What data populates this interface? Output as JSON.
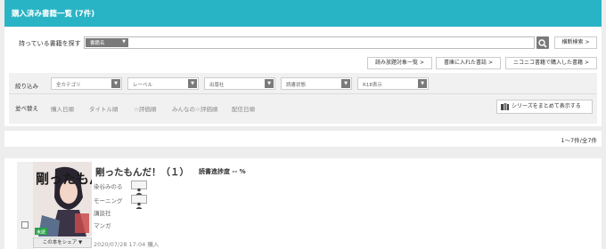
{
  "header": {
    "title": "購入済み書籍一覧 (7件)"
  },
  "search": {
    "label": "持っている書籍を探す",
    "select_value": "書籍名",
    "advanced_label": "横断検索 >"
  },
  "links": {
    "unlimited": "読み放題対象一覧 >",
    "bookshelf": "書庫に入れた書誌 >",
    "niconico": "ニコニコ書籍で購入した書籍 >"
  },
  "filter": {
    "label": "絞り込み",
    "selects": [
      "全カテゴリ",
      "レーベル",
      "出版社",
      "読書状態",
      "R18表示"
    ]
  },
  "sort": {
    "label": "並べ替え",
    "options": [
      "購入日順",
      "タイトル順",
      "☆評価順",
      "みんなの☆評価順",
      "配信日順"
    ]
  },
  "series_button": "シリーズをまとめて表示する",
  "count_text": "1〜7件/全7件",
  "book": {
    "title": "剛ったもんだ！（１）",
    "progress": "読書進捗度 -- %",
    "authors": [
      "染谷みのる",
      "モーニング"
    ],
    "publisher": "講談社",
    "category": "マンガ",
    "share": "この本をシェア ▼",
    "purchase_date": "2020/07/28 17:04 購入",
    "badge": "未読",
    "cover_title": "剛ったもんだ"
  },
  "colors": {
    "accent": "#29b4c5",
    "button_dark": "#7a7a7a"
  }
}
